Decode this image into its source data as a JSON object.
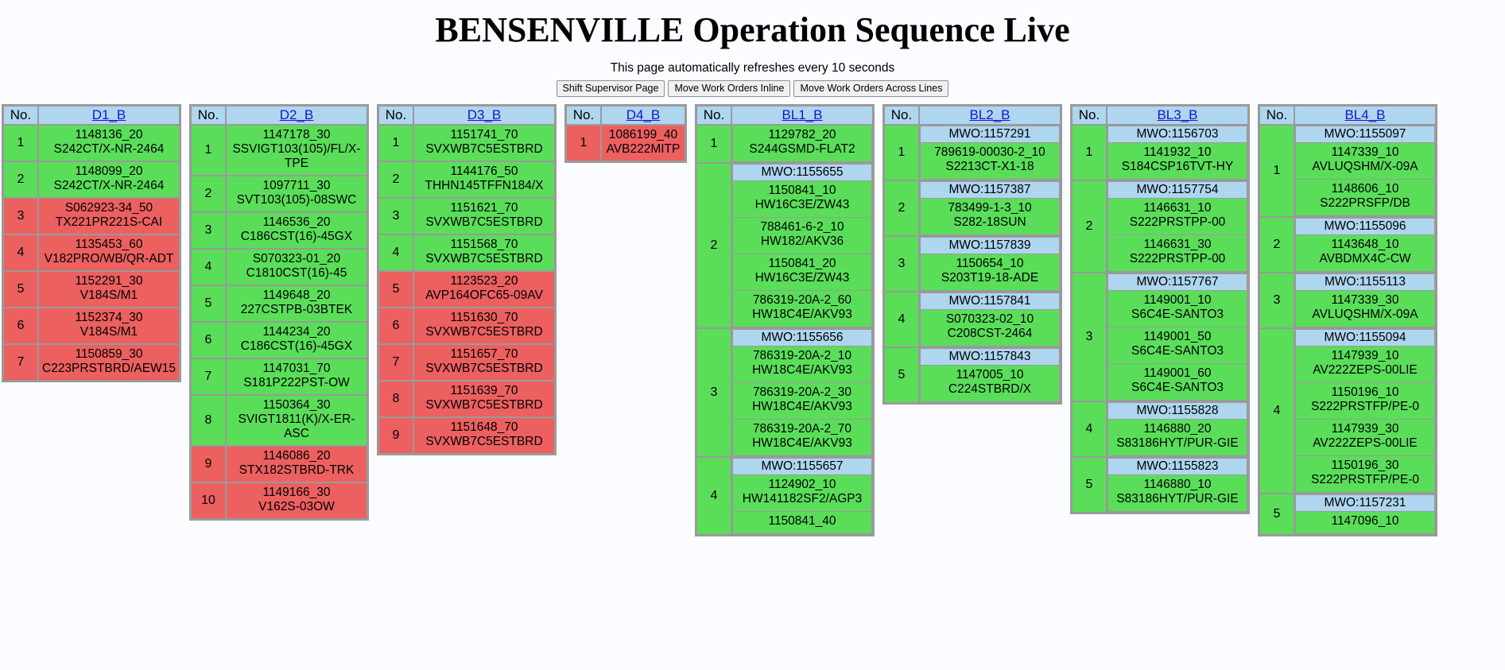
{
  "header": {
    "title": "BENSENVILLE Operation Sequence Live",
    "refresh_note": "This page automatically refreshes every 10 seconds",
    "buttons": [
      {
        "label": "Shift Supervisor Page",
        "name": "shift-supervisor-page-button"
      },
      {
        "label": "Move Work Orders Inline",
        "name": "move-work-orders-inline-button"
      },
      {
        "label": "Move Work Orders Across Lines",
        "name": "move-work-orders-across-lines-button"
      }
    ]
  },
  "colors": {
    "header_blue": "#aed6ef",
    "status_ok_green": "#5ade5a",
    "status_alert_red": "#ec6060",
    "link_blue": "#1414cf",
    "page_background": "#fafcff",
    "border_gray": "#9a9a9a"
  },
  "common": {
    "no_header": "No."
  },
  "tables": [
    {
      "name": "D1_B",
      "kind": "flat",
      "width_class": "w-d1",
      "rows": [
        {
          "no": "1",
          "status": "ok",
          "line1": "1148136_20",
          "line2": "S242CT/X-NR-2464"
        },
        {
          "no": "2",
          "status": "ok",
          "line1": "1148099_20",
          "line2": "S242CT/X-NR-2464"
        },
        {
          "no": "3",
          "status": "alert",
          "line1": "S062923-34_50",
          "line2": "TX221PR221S-CAI"
        },
        {
          "no": "4",
          "status": "alert",
          "line1": "1135453_60",
          "line2": "V182PRO/WB/QR-ADT"
        },
        {
          "no": "5",
          "status": "alert",
          "line1": "1152291_30",
          "line2": "V184S/M1"
        },
        {
          "no": "6",
          "status": "alert",
          "line1": "1152374_30",
          "line2": "V184S/M1"
        },
        {
          "no": "7",
          "status": "alert",
          "line1": "1150859_30",
          "line2": "C223PRSTBRD/AEW15"
        }
      ]
    },
    {
      "name": "D2_B",
      "kind": "flat",
      "width_class": "w-d2",
      "rows": [
        {
          "no": "1",
          "status": "ok",
          "line1": "1147178_30",
          "line2": "SSVIGT103(105)/FL/X-TPE"
        },
        {
          "no": "2",
          "status": "ok",
          "line1": "1097711_30",
          "line2": "SVT103(105)-08SWC"
        },
        {
          "no": "3",
          "status": "ok",
          "line1": "1146536_20",
          "line2": "C186CST(16)-45GX"
        },
        {
          "no": "4",
          "status": "ok",
          "line1": "S070323-01_20",
          "line2": "C1810CST(16)-45"
        },
        {
          "no": "5",
          "status": "ok",
          "line1": "1149648_20",
          "line2": "227CSTPB-03BTEK"
        },
        {
          "no": "6",
          "status": "ok",
          "line1": "1144234_20",
          "line2": "C186CST(16)-45GX"
        },
        {
          "no": "7",
          "status": "ok",
          "line1": "1147031_70",
          "line2": "S181P222PST-OW"
        },
        {
          "no": "8",
          "status": "ok",
          "line1": "1150364_30",
          "line2": "SVIGT1811(K)/X-ER-ASC"
        },
        {
          "no": "9",
          "status": "alert",
          "line1": "1146086_20",
          "line2": "STX182STBRD-TRK"
        },
        {
          "no": "10",
          "status": "alert",
          "line1": "1149166_30",
          "line2": "V162S-03OW"
        }
      ]
    },
    {
      "name": "D3_B",
      "kind": "flat",
      "width_class": "w-d3",
      "rows": [
        {
          "no": "1",
          "status": "ok",
          "line1": "1151741_70",
          "line2": "SVXWB7C5ESTBRD"
        },
        {
          "no": "2",
          "status": "ok",
          "line1": "1144176_50",
          "line2": "THHN145TFFN184/X"
        },
        {
          "no": "3",
          "status": "ok",
          "line1": "1151621_70",
          "line2": "SVXWB7C5ESTBRD"
        },
        {
          "no": "4",
          "status": "ok",
          "line1": "1151568_70",
          "line2": "SVXWB7C5ESTBRD"
        },
        {
          "no": "5",
          "status": "alert",
          "line1": "1123523_20",
          "line2": "AVP164OFC65-09AV"
        },
        {
          "no": "6",
          "status": "alert",
          "line1": "1151630_70",
          "line2": "SVXWB7C5ESTBRD"
        },
        {
          "no": "7",
          "status": "alert",
          "line1": "1151657_70",
          "line2": "SVXWB7C5ESTBRD"
        },
        {
          "no": "8",
          "status": "alert",
          "line1": "1151639_70",
          "line2": "SVXWB7C5ESTBRD"
        },
        {
          "no": "9",
          "status": "alert",
          "line1": "1151648_70",
          "line2": "SVXWB7C5ESTBRD"
        }
      ]
    },
    {
      "name": "D4_B",
      "kind": "flat",
      "width_class": "w-d4",
      "rows": [
        {
          "no": "1",
          "status": "alert",
          "line1": "1086199_40",
          "line2": "AVB222MITP"
        }
      ]
    },
    {
      "name": "BL1_B",
      "kind": "grouped",
      "width_class": "w-bl",
      "rows": [
        {
          "no": "1",
          "status": "ok",
          "mwo": null,
          "items": [
            {
              "status": "ok",
              "line1": "1129782_20",
              "line2": "S244GSMD-FLAT2"
            }
          ]
        },
        {
          "no": "2",
          "status": "ok",
          "mwo": "MWO:1155655",
          "items": [
            {
              "status": "ok",
              "line1": "1150841_10",
              "line2": "HW16C3E/ZW43"
            },
            {
              "status": "ok",
              "line1": "788461-6-2_10",
              "line2": "HW182/AKV36"
            },
            {
              "status": "ok",
              "line1": "1150841_20",
              "line2": "HW16C3E/ZW43"
            },
            {
              "status": "ok",
              "line1": "786319-20A-2_60",
              "line2": "HW18C4E/AKV93"
            }
          ]
        },
        {
          "no": "3",
          "status": "ok",
          "mwo": "MWO:1155656",
          "items": [
            {
              "status": "ok",
              "line1": "786319-20A-2_10",
              "line2": "HW18C4E/AKV93"
            },
            {
              "status": "ok",
              "line1": "786319-20A-2_30",
              "line2": "HW18C4E/AKV93"
            },
            {
              "status": "ok",
              "line1": "786319-20A-2_70",
              "line2": "HW18C4E/AKV93"
            }
          ]
        },
        {
          "no": "4",
          "status": "ok",
          "mwo": "MWO:1155657",
          "items": [
            {
              "status": "ok",
              "line1": "1124902_10",
              "line2": "HW141182SF2/AGP3"
            },
            {
              "status": "ok",
              "line1": "1150841_40",
              "line2": ""
            }
          ]
        }
      ]
    },
    {
      "name": "BL2_B",
      "kind": "grouped",
      "width_class": "w-bl",
      "rows": [
        {
          "no": "1",
          "status": "ok",
          "mwo": "MWO:1157291",
          "items": [
            {
              "status": "ok",
              "line1": "789619-00030-2_10",
              "line2": "S2213CT-X1-18"
            }
          ]
        },
        {
          "no": "2",
          "status": "ok",
          "mwo": "MWO:1157387",
          "items": [
            {
              "status": "ok",
              "line1": "783499-1-3_10",
              "line2": "S282-18SUN"
            }
          ]
        },
        {
          "no": "3",
          "status": "ok",
          "mwo": "MWO:1157839",
          "items": [
            {
              "status": "ok",
              "line1": "1150654_10",
              "line2": "S203T19-18-ADE"
            }
          ]
        },
        {
          "no": "4",
          "status": "ok",
          "mwo": "MWO:1157841",
          "items": [
            {
              "status": "ok",
              "line1": "S070323-02_10",
              "line2": "C208CST-2464"
            }
          ]
        },
        {
          "no": "5",
          "status": "ok",
          "mwo": "MWO:1157843",
          "items": [
            {
              "status": "ok",
              "line1": "1147005_10",
              "line2": "C224STBRD/X"
            }
          ]
        }
      ]
    },
    {
      "name": "BL3_B",
      "kind": "grouped",
      "width_class": "w-bl",
      "rows": [
        {
          "no": "1",
          "status": "ok",
          "mwo": "MWO:1156703",
          "items": [
            {
              "status": "ok",
              "line1": "1141932_10",
              "line2": "S184CSP16TVT-HY"
            }
          ]
        },
        {
          "no": "2",
          "status": "ok",
          "mwo": "MWO:1157754",
          "items": [
            {
              "status": "ok",
              "line1": "1146631_10",
              "line2": "S222PRSTPP-00"
            },
            {
              "status": "ok",
              "line1": "1146631_30",
              "line2": "S222PRSTPP-00"
            }
          ]
        },
        {
          "no": "3",
          "status": "ok",
          "mwo": "MWO:1157767",
          "items": [
            {
              "status": "ok",
              "line1": "1149001_10",
              "line2": "S6C4E-SANTO3"
            },
            {
              "status": "ok",
              "line1": "1149001_50",
              "line2": "S6C4E-SANTO3"
            },
            {
              "status": "ok",
              "line1": "1149001_60",
              "line2": "S6C4E-SANTO3"
            }
          ]
        },
        {
          "no": "4",
          "status": "ok",
          "mwo": "MWO:1155828",
          "items": [
            {
              "status": "ok",
              "line1": "1146880_20",
              "line2": "S83186HYT/PUR-GIE"
            }
          ]
        },
        {
          "no": "5",
          "status": "ok",
          "mwo": "MWO:1155823",
          "items": [
            {
              "status": "ok",
              "line1": "1146880_10",
              "line2": "S83186HYT/PUR-GIE"
            }
          ]
        }
      ]
    },
    {
      "name": "BL4_B",
      "kind": "grouped",
      "width_class": "w-bl",
      "rows": [
        {
          "no": "1",
          "status": "ok",
          "mwo": "MWO:1155097",
          "items": [
            {
              "status": "ok",
              "line1": "1147339_10",
              "line2": "AVLUQSHM/X-09A"
            },
            {
              "status": "ok",
              "line1": "1148606_10",
              "line2": "S222PRSFP/DB"
            }
          ]
        },
        {
          "no": "2",
          "status": "ok",
          "mwo": "MWO:1155096",
          "items": [
            {
              "status": "ok",
              "line1": "1143648_10",
              "line2": "AVBDMX4C-CW"
            }
          ]
        },
        {
          "no": "3",
          "status": "ok",
          "mwo": "MWO:1155113",
          "items": [
            {
              "status": "ok",
              "line1": "1147339_30",
              "line2": "AVLUQSHM/X-09A"
            }
          ]
        },
        {
          "no": "4",
          "status": "ok",
          "mwo": "MWO:1155094",
          "items": [
            {
              "status": "ok",
              "line1": "1147939_10",
              "line2": "AV222ZEPS-00LIE"
            },
            {
              "status": "ok",
              "line1": "1150196_10",
              "line2": "S222PRSTFP/PE-0"
            },
            {
              "status": "ok",
              "line1": "1147939_30",
              "line2": "AV222ZEPS-00LIE"
            },
            {
              "status": "ok",
              "line1": "1150196_30",
              "line2": "S222PRSTFP/PE-0"
            }
          ]
        },
        {
          "no": "5",
          "status": "ok",
          "mwo": "MWO:1157231",
          "items": [
            {
              "status": "ok",
              "line1": "1147096_10",
              "line2": ""
            }
          ]
        }
      ]
    }
  ]
}
